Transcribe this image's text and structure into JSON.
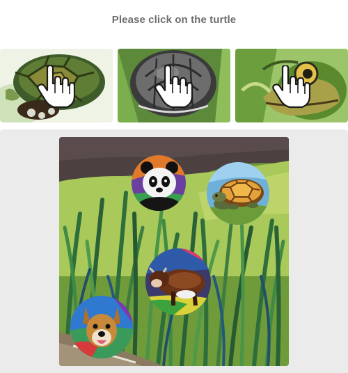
{
  "prompt": "Please click on the turtle",
  "examples": [
    {
      "subject": "turtle-shell-green",
      "icon": "pointer-hand-icon"
    },
    {
      "subject": "turtle-shell-grey",
      "icon": "pointer-hand-icon"
    },
    {
      "subject": "turtle-head-green",
      "icon": "pointer-hand-icon"
    }
  ],
  "scene": {
    "background": "grass-field",
    "tokens": [
      {
        "subject": "panda"
      },
      {
        "subject": "turtle"
      },
      {
        "subject": "cow"
      },
      {
        "subject": "dog"
      }
    ]
  },
  "colors": {
    "prompt_text": "#6d6d6d",
    "stage_background": "#ebebeb"
  }
}
